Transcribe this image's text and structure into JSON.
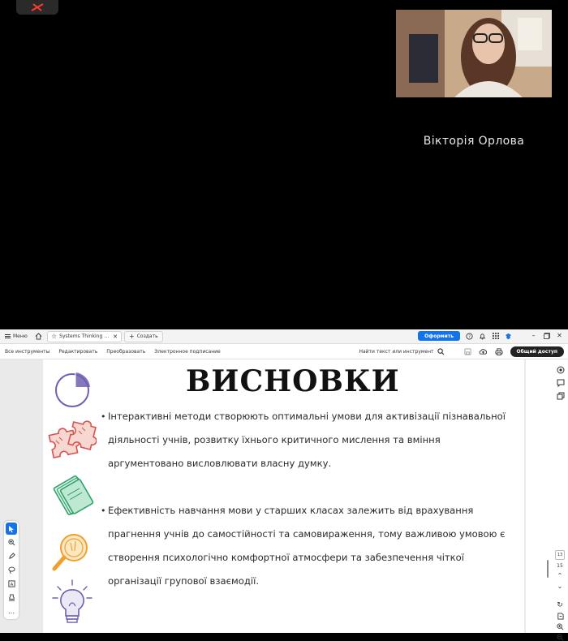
{
  "call": {
    "participant_name": "Вікторія Орлова"
  },
  "acrobat": {
    "menu_label": "Меню",
    "document_tab": "Systems Thinking Edu...",
    "new_tab_label": "Создать",
    "subscribe_button": "Оформить",
    "toolbar": {
      "all_tools": "Все инструменты",
      "edit": "Редактировать",
      "convert": "Преобразовать",
      "esign": "Электронное подписание",
      "search_placeholder": "Найти текст или инструмент",
      "share": "Общий доступ"
    },
    "page_nav": {
      "current": "13",
      "total": "15"
    }
  },
  "slide": {
    "title": "ВИСНОВКИ",
    "bullets": [
      "Інтерактивні методи створюють оптимальні умови для активізації пізнавальної діяльності учнів, розвитку їхнього критичного мислення та вміння аргументовано висловлювати власну думку.",
      "Ефективність навчання мови у старших класах залежить від врахування прагнення учнів до самостійності та самовираження, тому важливою умовою є створення психологічно комфортної атмосфери та забезпечення чіткої організації групової взаємодії."
    ]
  },
  "colors": {
    "accent": "#1473e6",
    "deco_purple": "#6f5fb0",
    "deco_red": "#d9534f",
    "deco_green": "#2fa36b",
    "deco_orange": "#f0a030"
  }
}
